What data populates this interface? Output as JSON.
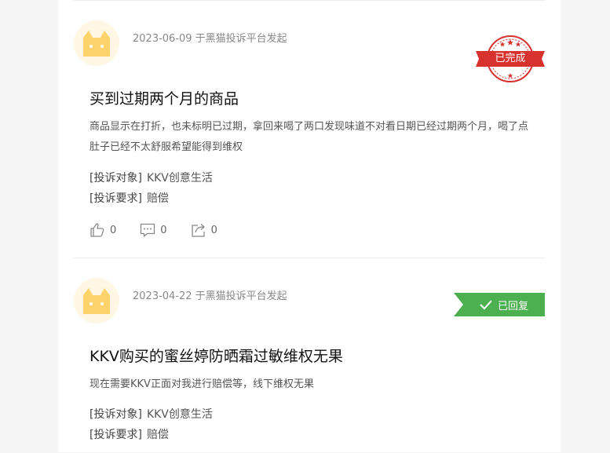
{
  "complaints": [
    {
      "date_line": "2023-06-09 于黑猫投诉平台发起",
      "status": "已完成",
      "title": "买到过期两个月的商品",
      "description": "商品显示在打折，也未标明已过期，拿回来喝了两口发现味道不对看日期已经过期两个月，喝了点肚子已经不太舒服希望能得到维权",
      "target_label": "[投诉对象]",
      "target_value": "KKV创意生活",
      "demand_label": "[投诉要求]",
      "demand_value": "赔偿",
      "likes": "0",
      "comments": "0",
      "shares": "0"
    },
    {
      "date_line": "2023-04-22 于黑猫投诉平台发起",
      "status": "已回复",
      "title": "KKV购买的蜜丝婷防晒霜过敏维权无果",
      "description": "现在需要KKV正面对我进行赔偿等，线下维权无果",
      "target_label": "[投诉对象]",
      "target_value": "KKV创意生活",
      "demand_label": "[投诉要求]",
      "demand_value": "赔偿"
    }
  ],
  "colors": {
    "stamp_red": "#d7322e",
    "replied_green": "#4caf50",
    "avatar_bg": "#fff6e3",
    "cat_yellow": "#ffd36b"
  }
}
